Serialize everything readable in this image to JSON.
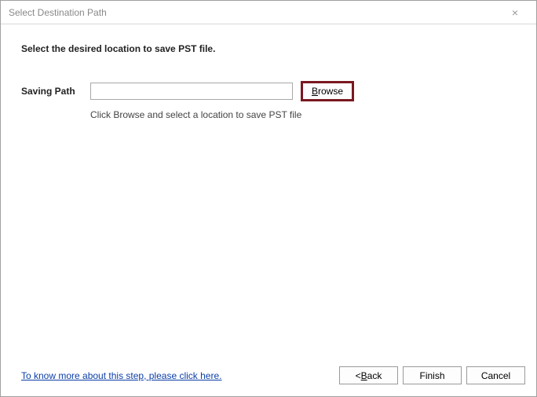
{
  "window": {
    "title": "Select Destination Path",
    "close": "×"
  },
  "main": {
    "instruction": "Select the desired location to save PST file.",
    "path_label": "Saving Path",
    "path_value": "",
    "browse_prefix": "B",
    "browse_rest": "rowse",
    "hint": "Click Browse and select a location to save PST file"
  },
  "footer": {
    "help_link": "To know more about this step, please click here.",
    "back_prefix": "< ",
    "back_accel": "B",
    "back_rest": "ack",
    "finish": "Finish",
    "cancel": "Cancel"
  }
}
